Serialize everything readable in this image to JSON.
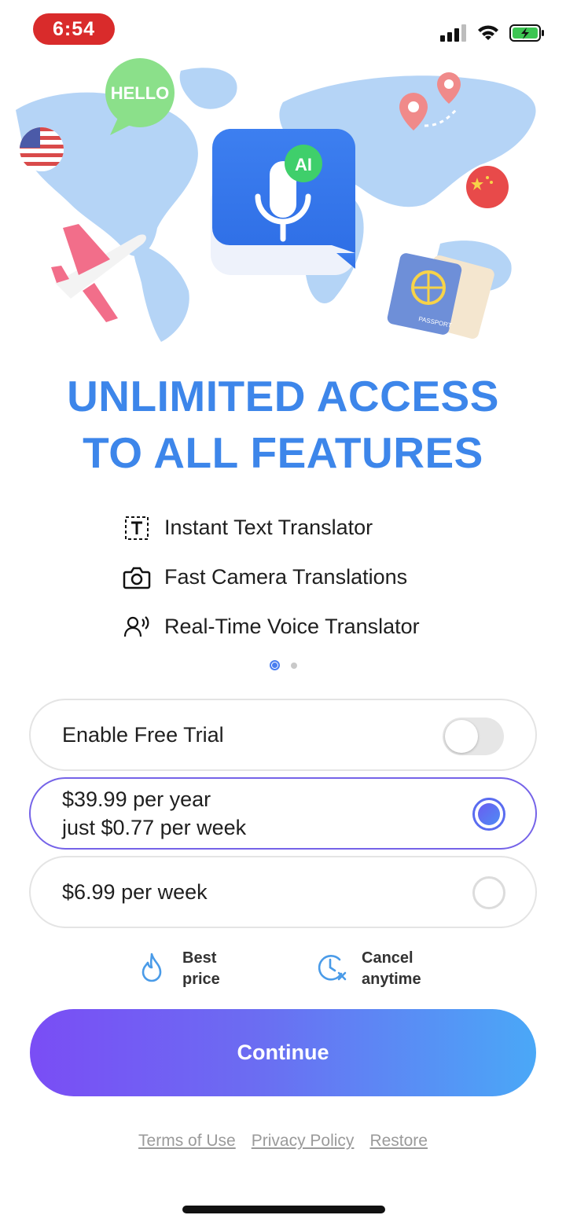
{
  "status_bar": {
    "time": "6:54",
    "icons": [
      "signal-icon",
      "wifi-icon",
      "battery-charging-icon"
    ],
    "time_pill_color": "#d92b2b"
  },
  "hero": {
    "bubble_text": "HELLO",
    "app_badge_text": "AI",
    "passport_text": "PASSPORT",
    "illustration": [
      "world-map",
      "us-flag",
      "china-flag",
      "airplane",
      "location-pins",
      "passport",
      "microphone-app-icon"
    ]
  },
  "headline": {
    "line1": "UNLIMITED ACCESS",
    "line2": "TO ALL FEATURES",
    "color": "#3d86ea"
  },
  "features": [
    {
      "icon": "text-icon",
      "label": "Instant Text Translator"
    },
    {
      "icon": "camera-icon",
      "label": "Fast Camera Translations"
    },
    {
      "icon": "voice-person-icon",
      "label": "Real-Time Voice Translator"
    }
  ],
  "pagination": {
    "total": 2,
    "active": 1
  },
  "options": {
    "free_trial": {
      "label": "Enable Free Trial",
      "enabled": false
    },
    "yearly": {
      "line1": "$39.99 per year",
      "line2": "just $0.77 per week",
      "selected": true
    },
    "weekly": {
      "label": "$6.99 per week",
      "selected": false
    }
  },
  "badges": {
    "best_price": {
      "line1": "Best",
      "line2": "price",
      "icon": "flame-icon"
    },
    "cancel": {
      "line1": "Cancel",
      "line2": "anytime",
      "icon": "clock-cancel-icon"
    }
  },
  "continue_label": "Continue",
  "footer": {
    "terms": "Terms of Use",
    "privacy": "Privacy Policy",
    "restore": "Restore"
  },
  "colors": {
    "accent_purple": "#7a4df5",
    "accent_blue": "#4aa8f7",
    "selected_border": "#7563e8"
  }
}
